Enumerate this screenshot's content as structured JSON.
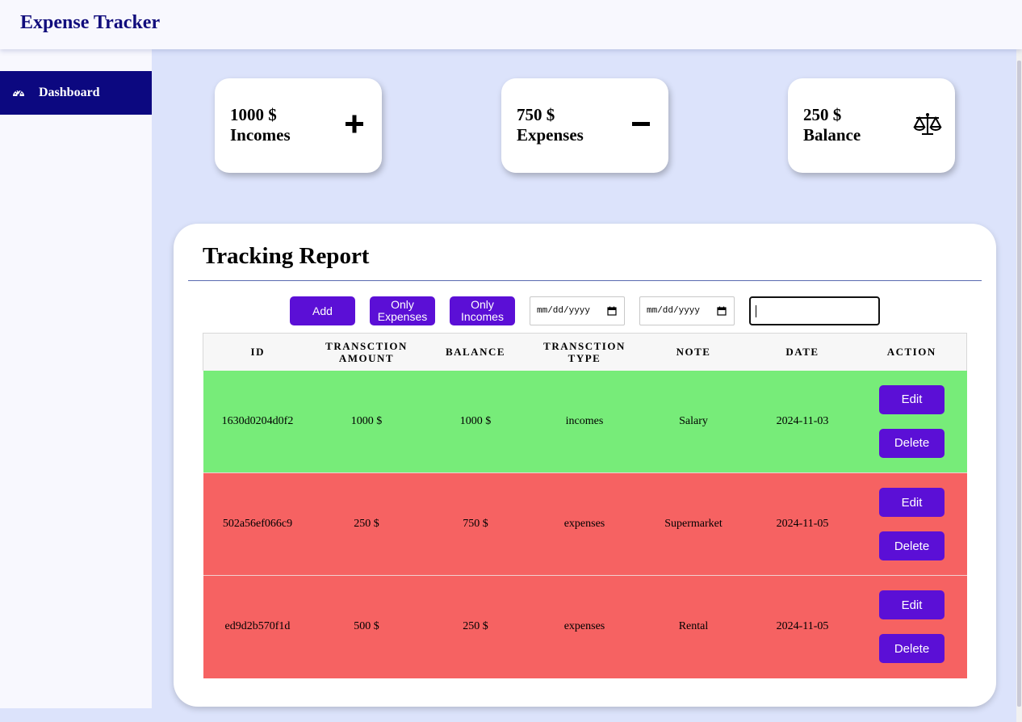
{
  "app": {
    "title": "Expense Tracker"
  },
  "sidebar": {
    "items": [
      {
        "label": "Dashboard",
        "icon": "dashboard-gauge-icon"
      }
    ]
  },
  "summary": {
    "incomes": {
      "amount": "1000 $",
      "label": "Incomes",
      "icon": "plus-icon"
    },
    "expenses": {
      "amount": "750 $",
      "label": "Expenses",
      "icon": "minus-icon"
    },
    "balance": {
      "amount": "250 $",
      "label": "Balance",
      "icon": "scale-icon"
    }
  },
  "report": {
    "title": "Tracking Report",
    "toolbar": {
      "add_label": "Add",
      "only_expenses_line1": "Only",
      "only_expenses_line2": "Expenses",
      "only_incomes_line1": "Only",
      "only_incomes_line2": "Incomes",
      "date_from_placeholder": "mm/dd/yyyy",
      "date_to_placeholder": "mm/dd/yyyy",
      "search_value": ""
    },
    "columns": {
      "id": "ID",
      "amount_line1": "TRANSCTION",
      "amount_line2": "AMOUNT",
      "balance": "BALANCE",
      "type_line1": "TRANSCTION",
      "type_line2": "TYPE",
      "note": "NOTE",
      "date": "DATE",
      "action": "ACTION"
    },
    "rows": [
      {
        "id": "1630d0204d0f2",
        "amount": "1000 $",
        "balance": "1000 $",
        "type": "incomes",
        "note": "Salary",
        "date": "2024-11-03",
        "edit": "Edit",
        "delete": "Delete"
      },
      {
        "id": "502a56ef066c9",
        "amount": "250 $",
        "balance": "750 $",
        "type": "expenses",
        "note": "Supermarket",
        "date": "2024-11-05",
        "edit": "Edit",
        "delete": "Delete"
      },
      {
        "id": "ed9d2b570f1d",
        "amount": "500 $",
        "balance": "250 $",
        "type": "expenses",
        "note": "Rental",
        "date": "2024-11-05",
        "edit": "Edit",
        "delete": "Delete"
      }
    ]
  },
  "colors": {
    "brand": "#110d7c",
    "button": "#5b0fd6",
    "income_row": "#77ec79",
    "expense_row": "#f66262",
    "page_bg": "#dce3fb"
  }
}
